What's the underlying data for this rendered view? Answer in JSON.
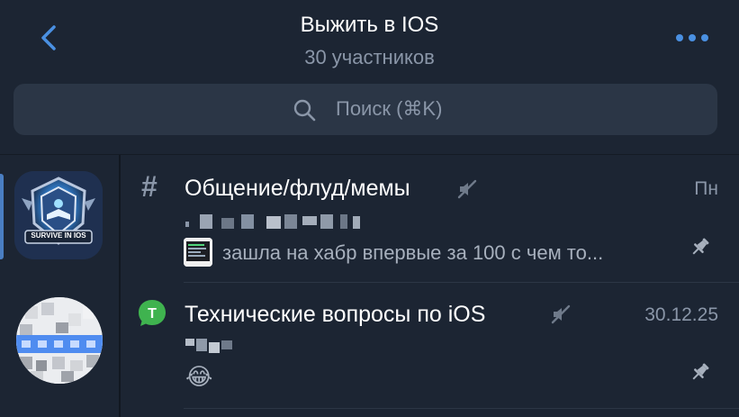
{
  "header": {
    "title": "Выжить в IOS",
    "subtitle": "30 участников"
  },
  "search": {
    "placeholder": "Поиск (⌘K)"
  },
  "sidebar": {
    "items": [
      {
        "name": "survive-in-ios",
        "selected": true,
        "logo_text": "SURVIVE IN IOS"
      },
      {
        "name": "blurred-avatar",
        "selected": false
      }
    ]
  },
  "topics": [
    {
      "icon": "hash-icon",
      "title": "Общение/флуд/мемы",
      "muted": true,
      "date": "Пн",
      "preview": "зашла на хабр впервые за 100 с чем то...",
      "pinned": true
    },
    {
      "icon": "green-topic-icon",
      "title": "Технические вопросы по iOS",
      "muted": true,
      "date": "30.12.25",
      "preview": "😂",
      "pinned": true
    }
  ],
  "colors": {
    "background": "#1c2533",
    "accent": "#4a90e2",
    "secondary_text": "#8a96a8",
    "search_bg": "#2b3646",
    "topic_green": "#3fb34f"
  }
}
